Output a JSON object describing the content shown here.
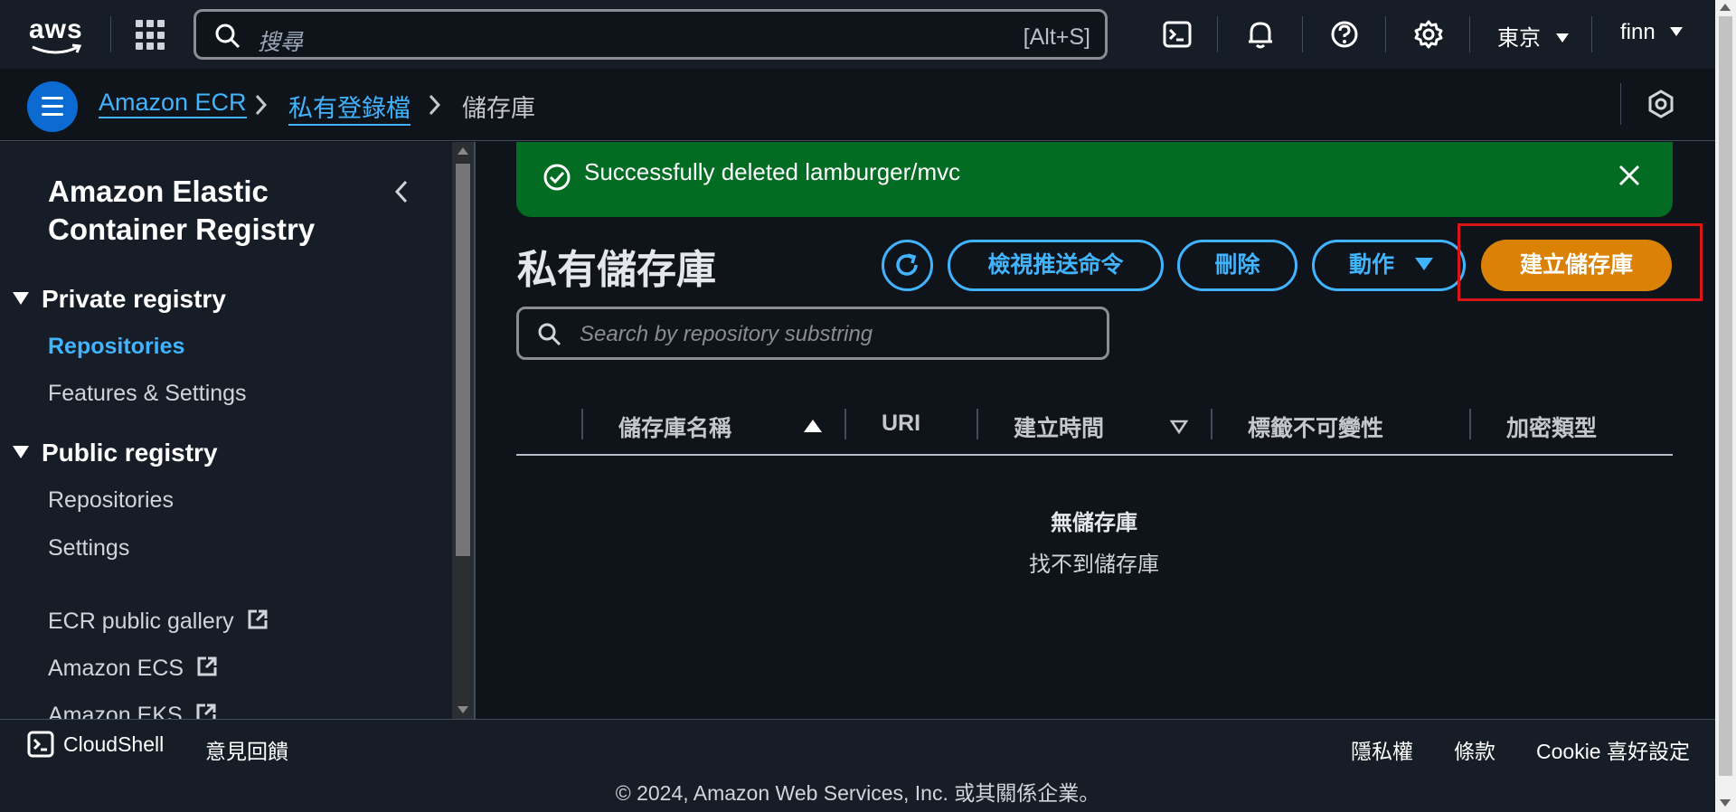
{
  "topnav": {
    "logo_text": "aws",
    "search_placeholder": "搜尋",
    "search_shortcut": "[Alt+S]",
    "region": "東京",
    "user": "finn"
  },
  "breadcrumb": {
    "items": [
      "Amazon ECR",
      "私有登錄檔",
      "儲存庫"
    ]
  },
  "sidebar": {
    "title": "Amazon Elastic Container Registry",
    "sections": [
      {
        "label": "Private registry",
        "items": [
          "Repositories",
          "Features & Settings"
        ]
      },
      {
        "label": "Public registry",
        "items": [
          "Repositories",
          "Settings"
        ]
      }
    ],
    "external_links": [
      "ECR public gallery",
      "Amazon ECS",
      "Amazon EKS"
    ]
  },
  "flash": {
    "message": "Successfully deleted lamburger/mvc",
    "type": "success"
  },
  "main": {
    "title": "私有儲存庫",
    "buttons": {
      "view_push": "檢視推送命令",
      "delete": "刪除",
      "actions": "動作",
      "create": "建立儲存庫"
    },
    "search_placeholder": "Search by repository substring",
    "columns": [
      "儲存庫名稱",
      "URI",
      "建立時間",
      "標籤不可變性",
      "加密類型"
    ],
    "empty_title": "無儲存庫",
    "empty_subtitle": "找不到儲存庫"
  },
  "footer": {
    "cloudshell": "CloudShell",
    "feedback": "意見回饋",
    "privacy": "隱私權",
    "terms": "條款",
    "cookie": "Cookie 喜好設定",
    "copyright": "© 2024, Amazon Web Services, Inc. 或其關係企業。"
  },
  "colors": {
    "accent": "#42b4ff",
    "primary_button": "#db8206",
    "success": "#036c23",
    "highlight": "#d91515"
  }
}
